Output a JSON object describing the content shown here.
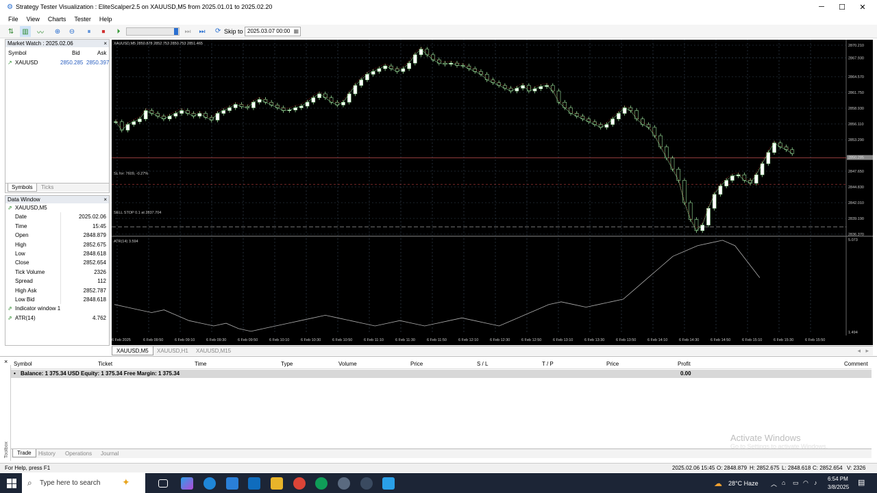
{
  "window": {
    "title": "Strategy Tester Visualization : EliteScalper2.5 on XAUUSD,M5 from 2025.01.01 to 2025.02.20"
  },
  "menu": [
    "File",
    "View",
    "Charts",
    "Tester",
    "Help"
  ],
  "toolbar": {
    "skip_label": "Skip to",
    "skip_value": "2025.03.07 00:00"
  },
  "market_watch": {
    "title": "Market Watch : 2025.02.06",
    "headers": [
      "Symbol",
      "Bid",
      "Ask"
    ],
    "rows": [
      {
        "symbol": "XAUUSD",
        "bid": "2850.285",
        "ask": "2850.397"
      }
    ],
    "tabs": [
      "Symbols",
      "Ticks"
    ]
  },
  "data_window": {
    "title": "Data Window",
    "symbol": "XAUUSD,M5",
    "rows": [
      {
        "label": "Date",
        "value": "2025.02.06"
      },
      {
        "label": "Time",
        "value": "15:45"
      },
      {
        "label": "Open",
        "value": "2848.879"
      },
      {
        "label": "High",
        "value": "2852.675"
      },
      {
        "label": "Low",
        "value": "2848.618"
      },
      {
        "label": "Close",
        "value": "2852.654"
      },
      {
        "label": "Tick Volume",
        "value": "2326"
      },
      {
        "label": "Spread",
        "value": "112"
      },
      {
        "label": "High Ask",
        "value": "2852.787"
      },
      {
        "label": "Low Bid",
        "value": "2848.618"
      }
    ],
    "indicator_title": "Indicator window 1",
    "indicator": {
      "label": "ATR(14)",
      "value": "4.762"
    }
  },
  "chart": {
    "header": "XAUUSD,M5  2850.878 2852.753 2850.753 2851.465",
    "sl_label": "SL for: 7609, -0.27%",
    "sell_stop_label": "SELL STOP 0.1 at 2837.704",
    "atr_label": "ATR(14) 3.594",
    "price_ticks": [
      "2870.210",
      "2867.930",
      "2864.570",
      "2861.750",
      "2858.930",
      "2856.110",
      "2853.290",
      "2847.650",
      "2844.830",
      "2842.010",
      "2839.190",
      "2836.370"
    ],
    "current_price": "2850.285",
    "atr_ticks": [
      "5.073",
      "1.494"
    ],
    "time_ticks": [
      "6 Feb 2025",
      "6 Feb 09:50",
      "6 Feb 09:10",
      "6 Feb 09:30",
      "6 Feb 09:50",
      "6 Feb 10:10",
      "6 Feb 10:30",
      "6 Feb 10:50",
      "6 Feb 11:10",
      "6 Feb 11:30",
      "6 Feb 11:50",
      "6 Feb 12:10",
      "6 Feb 12:30",
      "6 Feb 12:50",
      "6 Feb 13:10",
      "6 Feb 13:30",
      "6 Feb 13:50",
      "6 Feb 14:10",
      "6 Feb 14:30",
      "6 Feb 14:50",
      "6 Feb 15:10",
      "6 Feb 15:30",
      "6 Feb 15:50"
    ],
    "tabs": [
      "XAUUSD,M5",
      "XAUUSD,H1",
      "XAUUSD,M15"
    ]
  },
  "terminal": {
    "headers": [
      "Symbol",
      "Ticket",
      "Time",
      "Type",
      "Volume",
      "Price",
      "S / L",
      "T / P",
      "Price",
      "Profit",
      "Comment"
    ],
    "balance": "Balance: 1 375.34 USD  Equity: 1 375.34  Free Margin: 1 375.34",
    "profit": "0.00",
    "tabs": [
      "Trade",
      "History",
      "Operations",
      "Journal"
    ],
    "side_label": "Toolbox"
  },
  "watermark": {
    "line1": "Activate Windows",
    "line2": "Go to Settings to activate Windows."
  },
  "status": {
    "help": "For Help, press F1",
    "datetime": "2025.02.06 15:45",
    "o": "O: 2848.879",
    "h": "H: 2852.675",
    "l": "L: 2848.618",
    "c": "C: 2852.654",
    "v": "V: 2326"
  },
  "taskbar": {
    "search_placeholder": "Type here to search",
    "weather": "28°C  Haze",
    "time": "6:54 PM",
    "date": "3/8/2025"
  },
  "colors": {
    "chart_bg": "#000000",
    "grid": "#3a4a5a",
    "bull": "#ffffff",
    "line": "#9adf9a",
    "ma": "#cc2222",
    "atr": "#b0b0b0",
    "taskbar": "#1c2536"
  }
}
